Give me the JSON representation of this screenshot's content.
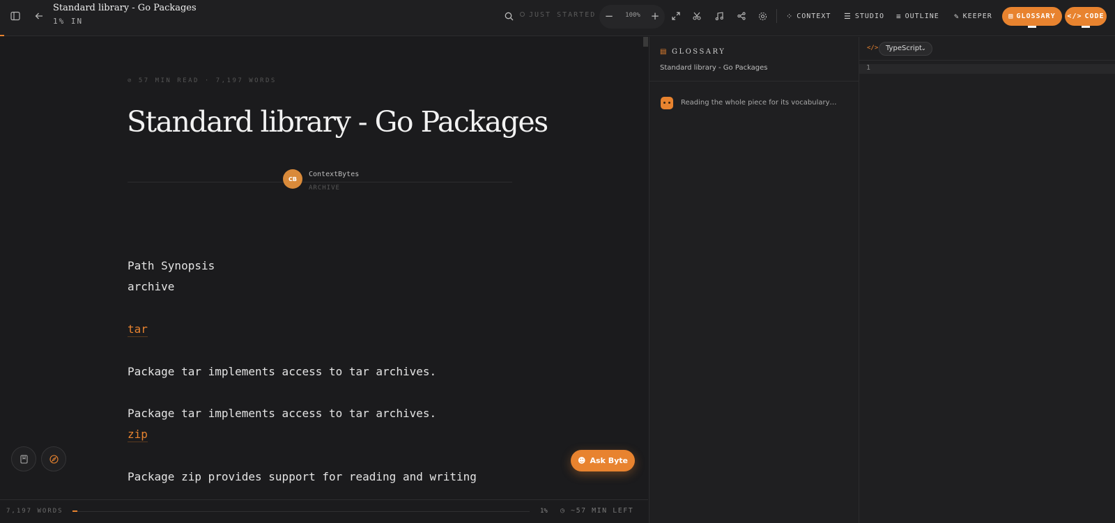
{
  "topbar": {
    "title": "Standard library - Go Packages",
    "progress_label": "1% IN",
    "status": "JUST STARTED",
    "zoom": "100%",
    "nav": {
      "context": "CONTEXT",
      "studio": "STUDIO",
      "outline": "OUTLINE",
      "keeper": "KEEPER",
      "glossary": "GLOSSARY",
      "code": "CODE"
    }
  },
  "article": {
    "meta": "57 MIN READ · 7,197 WORDS",
    "title": "Standard library - Go Packages",
    "author": {
      "initials": "CB",
      "name": "ContextBytes",
      "category": "ARCHIVE"
    },
    "lines": {
      "l1": "Path Synopsis",
      "l2": "archive",
      "link_tar": "tar",
      "l3": "Package tar implements access to tar archives.",
      "l4": "Package tar implements access to tar archives.",
      "link_zip": "zip",
      "l5": "Package zip provides support for reading and writing"
    }
  },
  "ask_button": "Ask Byte",
  "footer": {
    "words": "7,197 WORDS",
    "percent": "1%",
    "time_left": "~57 MIN LEFT",
    "progress": 0.01
  },
  "glossary_panel": {
    "heading": "GLOSSARY",
    "subtitle": "Standard library - Go Packages",
    "message": "Reading the whole piece for its vocabulary…"
  },
  "code_panel": {
    "language": "TypeScript",
    "line_number": "1"
  },
  "colors": {
    "accent": "#e8832f",
    "background": "#1b1b1d",
    "panel": "#1f1f21"
  }
}
